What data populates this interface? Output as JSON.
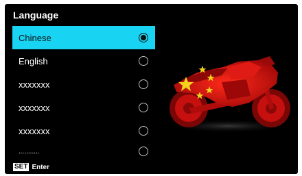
{
  "header": {
    "title": "Language"
  },
  "languages": [
    {
      "label": "Chinese",
      "selected": true
    },
    {
      "label": "English",
      "selected": false
    },
    {
      "label": "xxxxxxx",
      "selected": false
    },
    {
      "label": "xxxxxxx",
      "selected": false
    },
    {
      "label": "xxxxxxx",
      "selected": false
    },
    {
      "label": "...........",
      "selected": false
    }
  ],
  "footer": {
    "key_label": "SET",
    "action_label": "Enter"
  },
  "colors": {
    "accent": "#19d3f2",
    "bike_red": "#d41010",
    "star_yellow": "#f2d21c"
  },
  "illustration": {
    "icon": "motorcycle-china-flag-icon"
  }
}
